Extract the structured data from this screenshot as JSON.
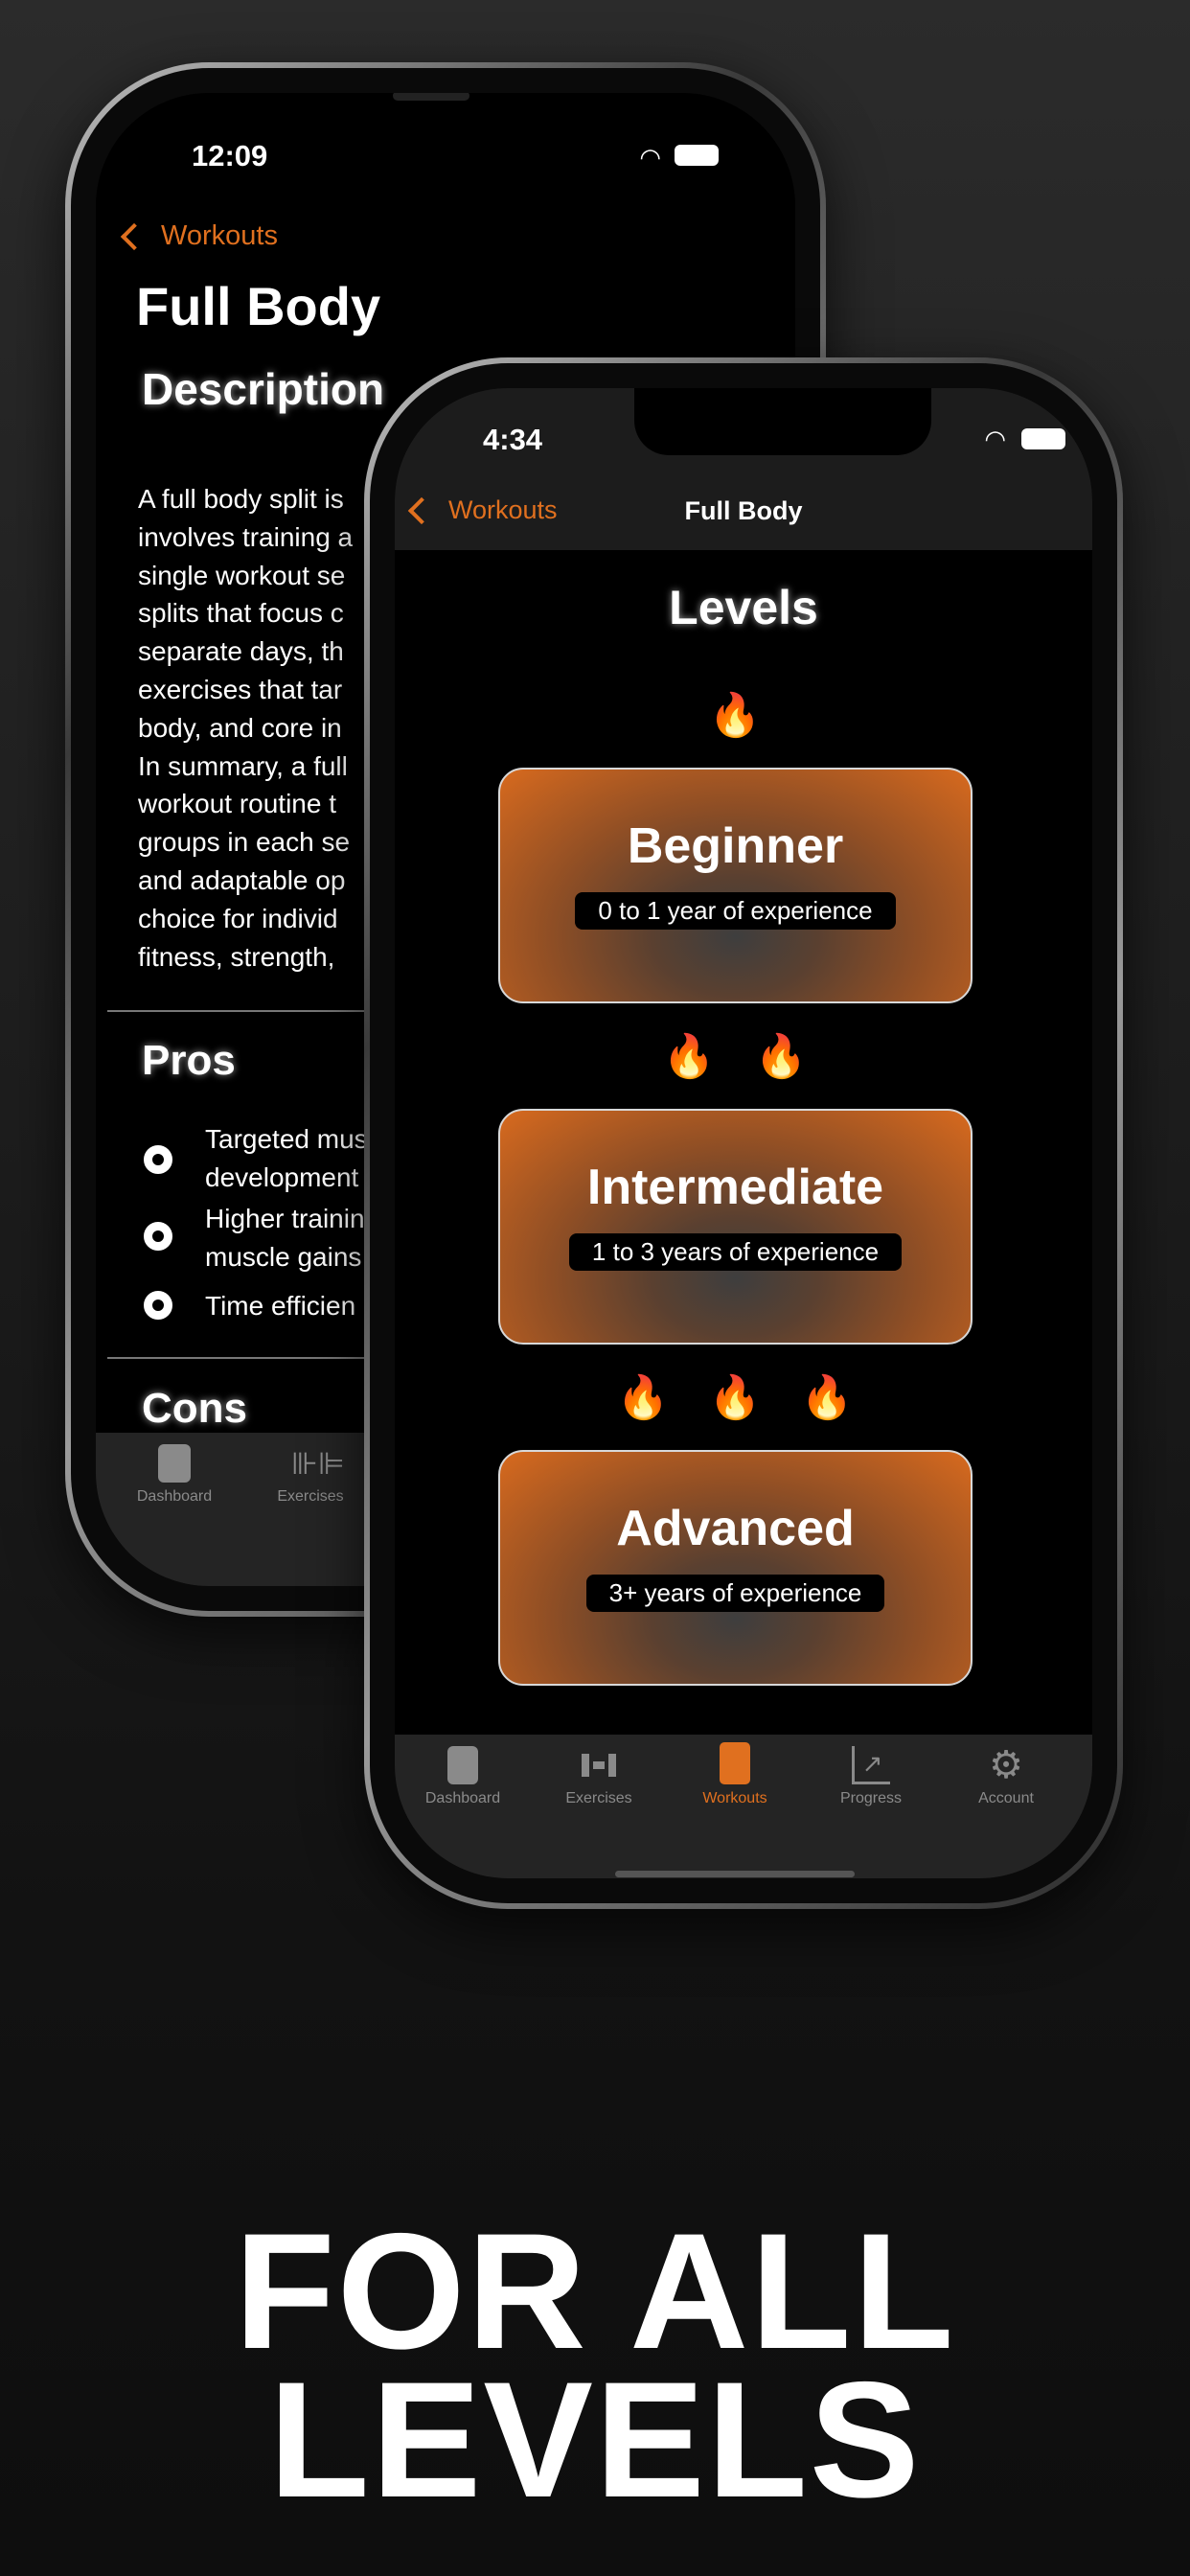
{
  "back_phone": {
    "time": "12:09",
    "back_label": "Workouts",
    "title": "Full Body",
    "section_description": "Description",
    "description_lines": [
      "A full body split is",
      "involves training a",
      "single workout se",
      "splits that focus c",
      "separate days, th",
      "exercises that tar",
      "body, and core in",
      "In summary, a full",
      "workout routine t",
      "groups in each se",
      "and adaptable op",
      "choice for individ",
      "fitness, strength,"
    ],
    "section_pros": "Pros",
    "pros": [
      [
        "Targeted mus",
        "development"
      ],
      [
        "Higher trainin",
        "muscle gains"
      ],
      [
        "Time efficien"
      ]
    ],
    "section_cons": "Cons",
    "tabs": [
      "Dashboard",
      "Exercises"
    ]
  },
  "front_phone": {
    "time": "4:34",
    "back_label": "Workouts",
    "nav_title": "Full Body",
    "heading": "Levels",
    "levels": [
      {
        "name": "Beginner",
        "experience": "0 to 1 year of experience",
        "flames": 1
      },
      {
        "name": "Intermediate",
        "experience": "1 to 3 years of experience",
        "flames": 2
      },
      {
        "name": "Advanced",
        "experience": "3+ years of experience",
        "flames": 3
      }
    ],
    "tabs": [
      {
        "label": "Dashboard",
        "icon": "dashboard-icon"
      },
      {
        "label": "Exercises",
        "icon": "dumbbell-icon"
      },
      {
        "label": "Workouts",
        "icon": "clipboard-icon",
        "active": true
      },
      {
        "label": "Progress",
        "icon": "chart-icon"
      },
      {
        "label": "Account",
        "icon": "gear-icon"
      }
    ]
  },
  "flame_glyph": "🔥",
  "caption": [
    "FOR ALL",
    "LEVELS"
  ],
  "colors": {
    "accent": "#e0701f",
    "tabbar": "#242424",
    "inactive": "#8a8a8a"
  }
}
